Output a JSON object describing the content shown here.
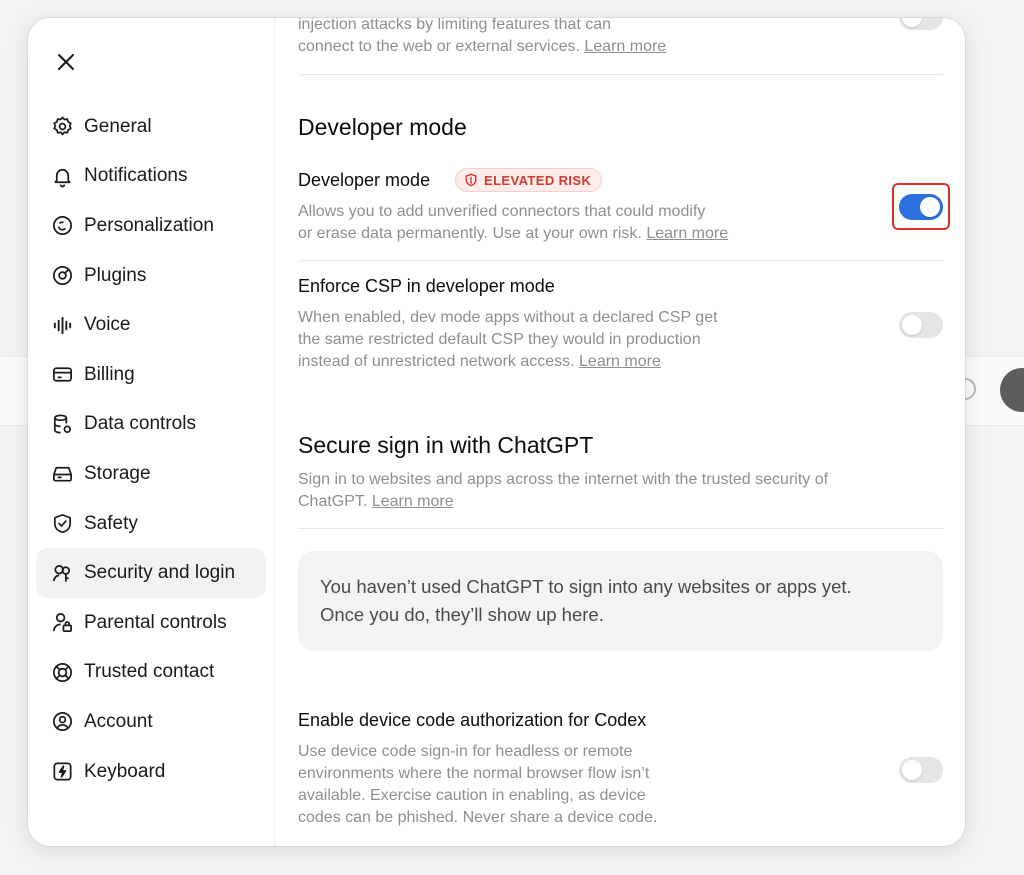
{
  "sidebar": {
    "items": [
      {
        "label": "General",
        "icon": "gear-icon"
      },
      {
        "label": "Notifications",
        "icon": "bell-icon"
      },
      {
        "label": "Personalization",
        "icon": "personalization-icon"
      },
      {
        "label": "Plugins",
        "icon": "plugins-icon"
      },
      {
        "label": "Voice",
        "icon": "voice-waveform-icon"
      },
      {
        "label": "Billing",
        "icon": "credit-card-icon"
      },
      {
        "label": "Data controls",
        "icon": "database-gear-icon"
      },
      {
        "label": "Storage",
        "icon": "storage-drive-icon"
      },
      {
        "label": "Safety",
        "icon": "shield-check-icon"
      },
      {
        "label": "Security and login",
        "icon": "security-people-icon"
      },
      {
        "label": "Parental controls",
        "icon": "parental-lock-icon"
      },
      {
        "label": "Trusted contact",
        "icon": "lifebuoy-icon"
      },
      {
        "label": "Account",
        "icon": "account-circle-icon"
      },
      {
        "label": "Keyboard",
        "icon": "keyboard-bolt-icon"
      }
    ],
    "active_item": "Security and login"
  },
  "content": {
    "top_partial": {
      "line1": "injection attacks by limiting features that can",
      "line2": "connect to the web or external services.",
      "learn_more": "Learn more"
    },
    "developer_section": {
      "heading": "Developer mode",
      "dev_mode": {
        "label": "Developer mode",
        "badge": "ELEVATED RISK",
        "desc_line1": "Allows you to add unverified connectors that could modify",
        "desc_line2": "or erase data permanently. Use at your own risk.",
        "learn_more": "Learn more",
        "enabled": true
      },
      "enforce_csp": {
        "label": "Enforce CSP in developer mode",
        "desc_line1": "When enabled, dev mode apps without a declared CSP get",
        "desc_line2": "the same restricted default CSP they would in production",
        "desc_line3": "instead of unrestricted network access.",
        "learn_more": "Learn more",
        "enabled": false
      }
    },
    "secure_signin": {
      "heading": "Secure sign in with ChatGPT",
      "desc_line1": "Sign in to websites and apps across the internet with the trusted security of",
      "desc_line2": "ChatGPT.",
      "learn_more": "Learn more",
      "empty_line1": "You haven’t used ChatGPT to sign into any websites or apps yet.",
      "empty_line2": "Once you do, they’ll show up here."
    },
    "device_code": {
      "label": "Enable device code authorization for Codex",
      "desc_line1": "Use device code sign-in for headless or remote",
      "desc_line2": "environments where the normal browser flow isn’t",
      "desc_line3": "available. Exercise caution in enabling, as device",
      "desc_line4": "codes can be phished. Never share a device code.",
      "enabled": false
    }
  },
  "colors": {
    "toggle_on": "#2b6fe0",
    "toggle_off": "#e5e5e5",
    "risk_badge_text": "#d23a31",
    "highlight_box": "#d9302c"
  }
}
